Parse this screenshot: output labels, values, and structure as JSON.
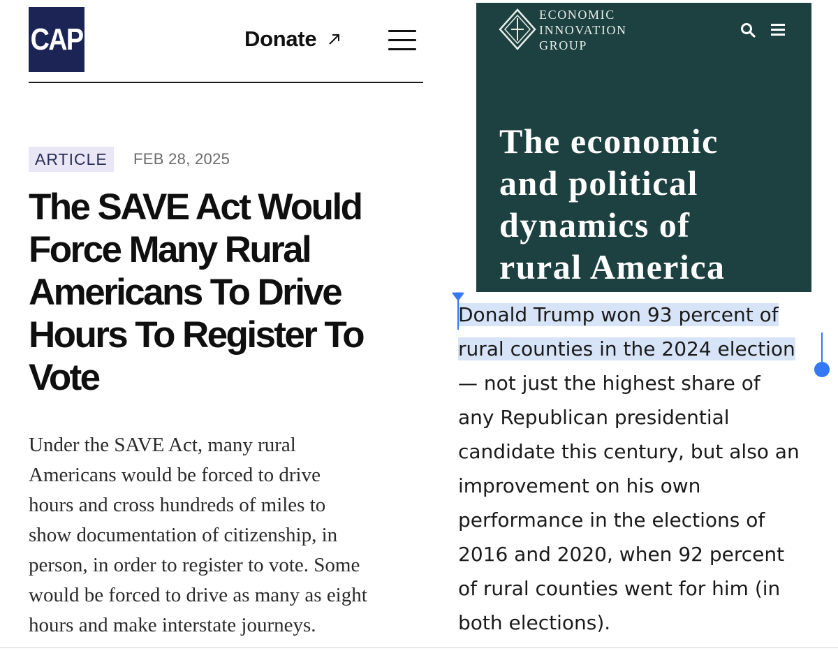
{
  "cap": {
    "logo_text": "CAP",
    "donate_label": "Donate",
    "tag": "ARTICLE",
    "date": "FEB 28, 2025",
    "headline": "The SAVE Act Would Force Many Rural Americans To Drive Hours To Register To Vote",
    "headline_lines": [
      "The SAVE Act Would",
      "Force Many Rural",
      "Americans To Drive",
      "Hours To Register To",
      "Vote"
    ],
    "summary_lines": [
      "Under the SAVE Act, many rural",
      "Americans would be forced to drive",
      "hours and cross hundreds of miles to",
      "show documentation of citizenship, in",
      "person, in order to register to vote. Some",
      "would be forced to drive as many as eight",
      "hours and make interstate journeys."
    ]
  },
  "eig": {
    "org_name_lines": [
      "ECONOMIC",
      "INNOVATION",
      "GROUP"
    ],
    "title_lines": [
      "The economic",
      "and political",
      "dynamics of",
      "rural America"
    ],
    "body_lines": [
      "Donald Trump won 93 percent of",
      "rural counties in the 2024 election",
      "— not just the highest share of",
      "any Republican presidential",
      "candidate this century, but also an",
      "improvement on his own",
      "performance in the elections of",
      "2016 and 2020, when 92 percent",
      "of rural counties went for him (in",
      "both elections)."
    ],
    "selected_text": "Donald Trump won 93 percent of rural counties in the 2024 election"
  },
  "colors": {
    "cap_navy": "#1c2456",
    "tag_bg": "#e9e6f6",
    "eig_green": "#1d4040",
    "selection_highlight": "#d7e3f7",
    "selection_handle": "#3478f6"
  },
  "icons": {
    "donate_arrow": "external-arrow-icon",
    "cap_menu": "hamburger-icon",
    "eig_logo": "diamond-logo-icon",
    "eig_search": "search-icon",
    "eig_menu": "hamburger-icon"
  }
}
